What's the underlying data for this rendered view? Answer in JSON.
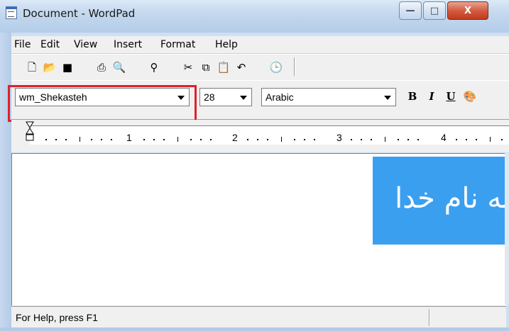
{
  "window": {
    "title": "Document - WordPad",
    "controls": {
      "minimize": "—",
      "maximize": "□",
      "close": "X"
    }
  },
  "menu": {
    "items": [
      "File",
      "Edit",
      "View",
      "Insert",
      "Format",
      "Help"
    ]
  },
  "toolbar": {
    "icons": [
      "new-icon",
      "open-icon",
      "save-icon",
      "print-icon",
      "print-preview-icon",
      "find-icon",
      "cut-icon",
      "copy-icon",
      "paste-icon",
      "undo-icon",
      "date-time-icon"
    ]
  },
  "format_bar": {
    "font_name": "wm_Shekasteh",
    "font_size": "28",
    "script": "Arabic",
    "bold_label": "B",
    "italic_label": "I",
    "underline_label": "U",
    "color_icon": "palette-icon"
  },
  "ruler": {
    "numbers": [
      "1",
      "2",
      "3",
      "4"
    ]
  },
  "document": {
    "image_text": "به نام خدا",
    "image_color": "#3b9ff0"
  },
  "statusbar": {
    "text": "For Help, press F1"
  },
  "colors": {
    "highlight": "#e0202a",
    "close_button": "#c23a1e"
  }
}
